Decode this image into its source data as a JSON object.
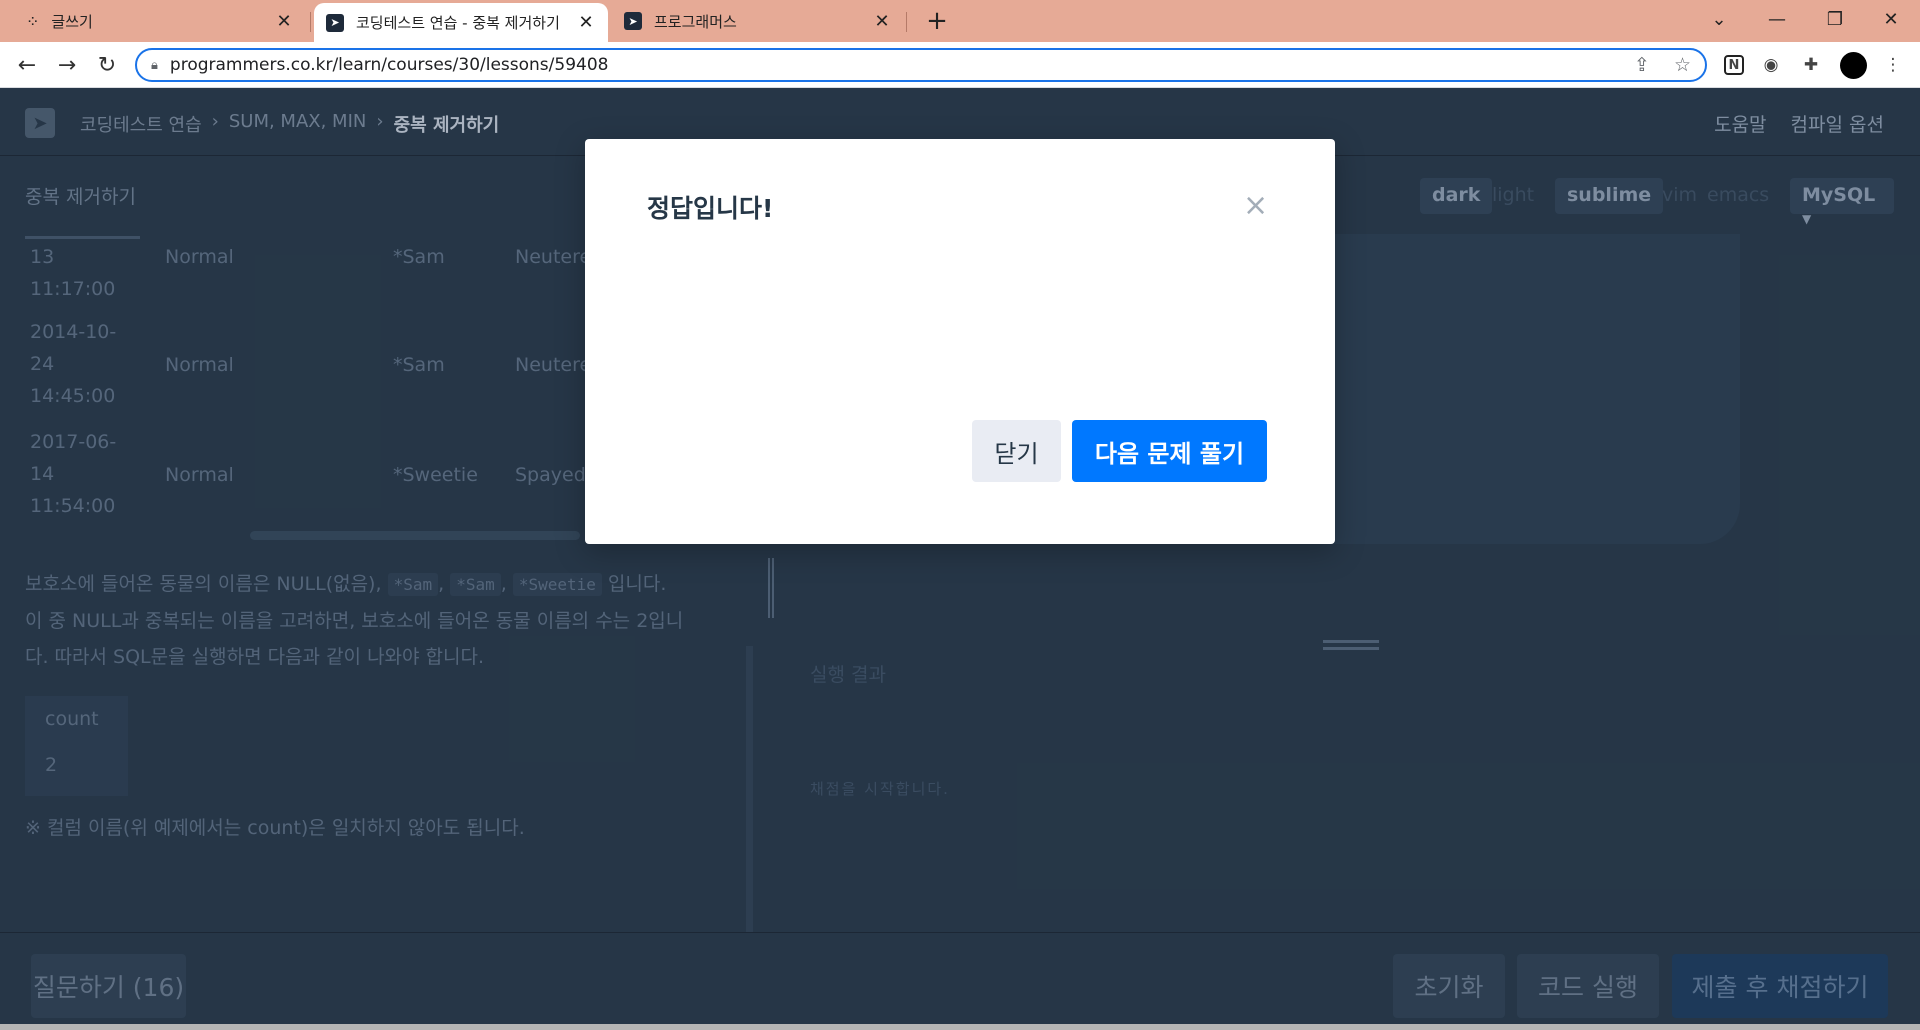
{
  "browser": {
    "tabs": [
      {
        "title": "글쓰기",
        "icon": "notion-dots-icon"
      },
      {
        "title": "코딩테스트 연습 - 중복 제거하기",
        "icon": "programmers-icon",
        "active": true
      },
      {
        "title": "프로그래머스",
        "icon": "programmers-icon"
      }
    ],
    "url": "programmers.co.kr/learn/courses/30/lessons/59408"
  },
  "header": {
    "breadcrumb": [
      "코딩테스트 연습",
      "SUM, MAX, MIN",
      "중복 제거하기"
    ],
    "help": "도움말",
    "compile_options": "컴파일 옵션"
  },
  "problem": {
    "title": "중복 제거하기",
    "rows": [
      {
        "datetime": [
          "13",
          "11:17:00"
        ],
        "intake": "Normal",
        "name": "*Sam",
        "sex": "Neutere"
      },
      {
        "datetime": [
          "2014-10-",
          "24",
          "14:45:00"
        ],
        "intake": "Normal",
        "name": "*Sam",
        "sex": "Neutere"
      },
      {
        "datetime": [
          "2017-06-",
          "14",
          "11:54:00"
        ],
        "intake": "Normal",
        "name": "*Sweetie",
        "sex": "Spayed"
      }
    ],
    "paragraph": {
      "line1_pre": "보호소에 들어온 동물의 이름은 NULL(없음),",
      "code1": "*Sam",
      "sep1": ",",
      "code2": "*Sam",
      "sep2": ",",
      "code3": "*Sweetie",
      "line1_post": "입니다.",
      "line2": "이 중 NULL과 중복되는 이름을 고려하면, 보호소에 들어온 동물 이름의 수는 2입니",
      "line3": "다. 따라서 SQL문을 실행하면 다음과 같이 나와야 합니다."
    },
    "result_table": {
      "header": "count",
      "value": "2"
    },
    "note": "※ 컬럼 이름(위 예제에서는 count)은 일치하지 않아도 됩니다."
  },
  "editor": {
    "themes": [
      "dark",
      "light"
    ],
    "keymaps": [
      "sublime",
      "vim",
      "emacs"
    ],
    "language": "MySQL",
    "result_label": "실행 결과",
    "result_message": "채점을 시작합니다."
  },
  "footer": {
    "question_button": "질문하기 (16)",
    "reset_button": "초기화",
    "run_button": "코드 실행",
    "submit_button": "제출 후 채점하기"
  },
  "modal": {
    "title": "정답입니다!",
    "close_button": "닫기",
    "next_button": "다음 문제 풀기",
    "close_symbol": "×"
  }
}
